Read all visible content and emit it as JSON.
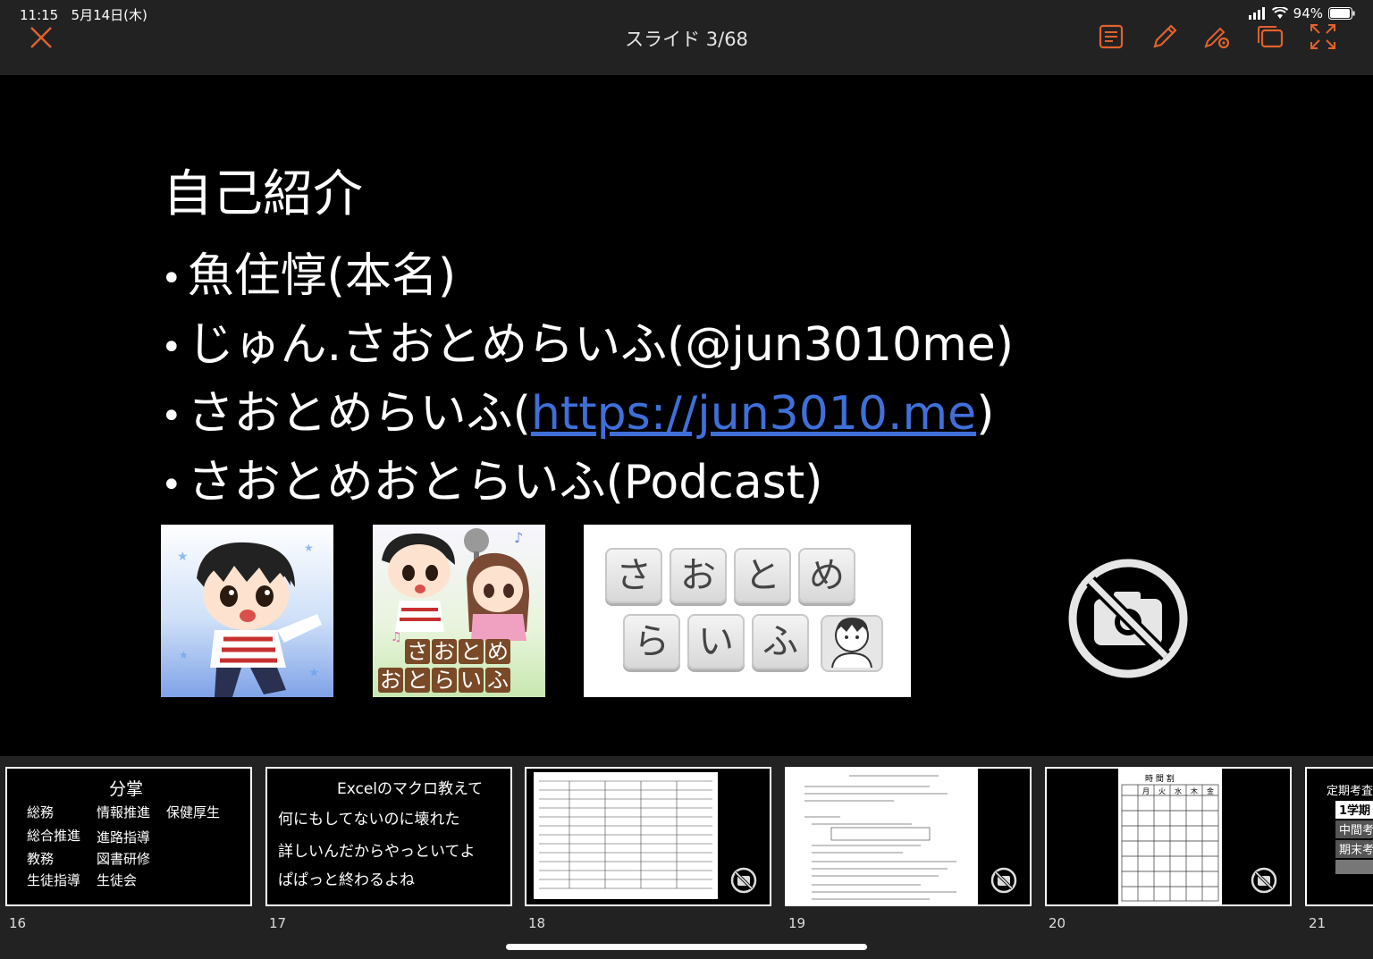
{
  "status": {
    "time": "11:15",
    "date": "5月14日(木)",
    "battery": "94%"
  },
  "header": {
    "title": "スライド 3/68"
  },
  "slide": {
    "heading": "自己紹介",
    "bullets": [
      {
        "before": "魚住惇(本名)",
        "link": "",
        "after": ""
      },
      {
        "before": "じゅん.さおとめらいふ(@jun3010me)",
        "link": "",
        "after": ""
      },
      {
        "before": "さおとめらいふ(",
        "link": "https://jun3010.me",
        "after": ")"
      },
      {
        "before": "さおとめおとらいふ(Podcast)",
        "link": "",
        "after": ""
      }
    ],
    "podcast_label": [
      "さおとめ",
      "おとらいふ"
    ],
    "keys_row1": [
      "さ",
      "お",
      "と",
      "め"
    ],
    "keys_row2": [
      "ら",
      "い",
      "ふ"
    ]
  },
  "thumbnails": [
    {
      "num": "16",
      "title": "分掌",
      "items": [
        "総務",
        "情報推進",
        "保健厚生",
        "総合推進",
        "進路指導",
        "教務",
        "図書研修",
        "生徒指導",
        "生徒会"
      ]
    },
    {
      "num": "17",
      "lines": [
        "Excelのマクロ教えて",
        "何にもしてないのに壊れた",
        "詳しいんだからやっといてよ",
        "ぱぱっと終わるよね"
      ]
    },
    {
      "num": "18"
    },
    {
      "num": "19"
    },
    {
      "num": "20",
      "title": "時 間 割",
      "days": [
        "月",
        "火",
        "水",
        "木",
        "金"
      ]
    },
    {
      "num": "21",
      "title": "定期考査(",
      "rows": [
        "1学期",
        "中間考",
        "期末考"
      ]
    }
  ],
  "colors": {
    "accent": "#e0622e",
    "link": "#3f6fd8"
  },
  "icons": [
    "close-icon",
    "notes-icon",
    "pen-icon",
    "markup-settings-icon",
    "window-icon",
    "expand-icon",
    "no-camera-icon"
  ]
}
